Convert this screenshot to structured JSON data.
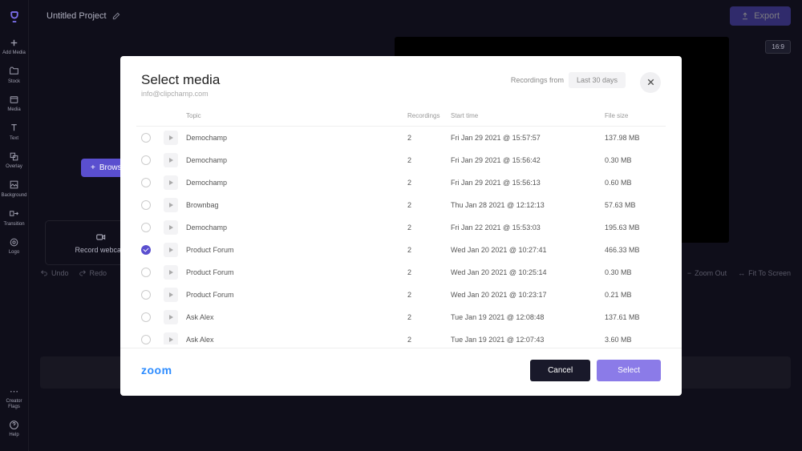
{
  "sidebar": {
    "items": [
      {
        "label": "Add Media",
        "icon": "plus-icon"
      },
      {
        "label": "Stock",
        "icon": "folder-icon"
      },
      {
        "label": "Media",
        "icon": "media-icon"
      },
      {
        "label": "Text",
        "icon": "text-icon"
      },
      {
        "label": "Overlay",
        "icon": "overlay-icon"
      },
      {
        "label": "Background",
        "icon": "background-icon"
      },
      {
        "label": "Transition",
        "icon": "transition-icon"
      },
      {
        "label": "Logo",
        "icon": "logo-icon"
      }
    ],
    "bottom": {
      "creator_flags": "Creator Flags",
      "help": "Help"
    }
  },
  "header": {
    "project_title": "Untitled Project",
    "export_label": "Export"
  },
  "stage": {
    "aspect": "16:9",
    "browse_label": "Browse",
    "record_webcam_label": "Record webcam"
  },
  "toolbar": {
    "undo": "Undo",
    "redo": "Redo",
    "zoom_out": "Zoom Out",
    "fit_to_screen": "Fit To Screen"
  },
  "modal": {
    "title": "Select media",
    "subtitle": "info@clipchamp.com",
    "recordings_from_label": "Recordings from",
    "recordings_from_value": "Last 30 days",
    "columns": {
      "topic": "Topic",
      "recordings": "Recordings",
      "start": "Start time",
      "size": "File size"
    },
    "rows": [
      {
        "topic": "Demochamp",
        "recordings": "2",
        "start": "Fri Jan 29 2021 @ 15:57:57",
        "size": "137.98 MB",
        "selected": false
      },
      {
        "topic": "Demochamp",
        "recordings": "2",
        "start": "Fri Jan 29 2021 @ 15:56:42",
        "size": "0.30 MB",
        "selected": false
      },
      {
        "topic": "Demochamp",
        "recordings": "2",
        "start": "Fri Jan 29 2021 @ 15:56:13",
        "size": "0.60 MB",
        "selected": false
      },
      {
        "topic": "Brownbag",
        "recordings": "2",
        "start": "Thu Jan 28 2021 @ 12:12:13",
        "size": "57.63 MB",
        "selected": false
      },
      {
        "topic": "Demochamp",
        "recordings": "2",
        "start": "Fri Jan 22 2021 @ 15:53:03",
        "size": "195.63 MB",
        "selected": false
      },
      {
        "topic": "Product Forum",
        "recordings": "2",
        "start": "Wed Jan 20 2021 @ 10:27:41",
        "size": "466.33 MB",
        "selected": true
      },
      {
        "topic": "Product Forum",
        "recordings": "2",
        "start": "Wed Jan 20 2021 @ 10:25:14",
        "size": "0.30 MB",
        "selected": false
      },
      {
        "topic": "Product Forum",
        "recordings": "2",
        "start": "Wed Jan 20 2021 @ 10:23:17",
        "size": "0.21 MB",
        "selected": false
      },
      {
        "topic": "Ask Alex",
        "recordings": "2",
        "start": "Tue Jan 19 2021 @ 12:08:48",
        "size": "137.61 MB",
        "selected": false
      },
      {
        "topic": "Ask Alex",
        "recordings": "2",
        "start": "Tue Jan 19 2021 @ 12:07:43",
        "size": "3.60 MB",
        "selected": false
      }
    ],
    "provider_logo": "zoom",
    "cancel_label": "Cancel",
    "select_label": "Select"
  }
}
